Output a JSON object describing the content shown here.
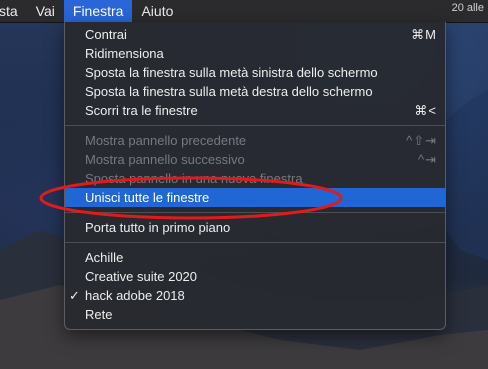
{
  "menubar": {
    "items": [
      "sta",
      "Vai",
      "Finestra",
      "Aiuto"
    ],
    "clock_fragment": "20 alle"
  },
  "menu": {
    "group1": [
      {
        "label": "Contrai",
        "shortcut": "⌘M"
      },
      {
        "label": "Ridimensiona",
        "shortcut": ""
      },
      {
        "label": "Sposta la finestra sulla metà sinistra dello schermo",
        "shortcut": ""
      },
      {
        "label": "Sposta la finestra sulla metà destra dello schermo",
        "shortcut": ""
      },
      {
        "label": "Scorri tra le finestre",
        "shortcut": "⌘<"
      }
    ],
    "group2": [
      {
        "label": "Mostra pannello precedente",
        "shortcut": "^⇧⇥",
        "disabled": true
      },
      {
        "label": "Mostra pannello successivo",
        "shortcut": "^⇥",
        "disabled": true
      },
      {
        "label": "Sposta pannello in una nuova finestra",
        "shortcut": "",
        "disabled": true
      },
      {
        "label": "Unisci tutte le finestre",
        "shortcut": "",
        "highlighted": true
      }
    ],
    "group3": [
      {
        "label": "Porta tutto in primo piano"
      }
    ],
    "group4": [
      {
        "label": "Achille",
        "checked": false
      },
      {
        "label": "Creative suite 2020",
        "checked": false
      },
      {
        "label": "hack adobe 2018",
        "checked": true,
        "check_glyph": "✓"
      },
      {
        "label": "Rete",
        "checked": false
      }
    ]
  },
  "colors": {
    "highlight": "#2066d4",
    "annotation": "#e01b1b",
    "menubar_active": "#2a66d8"
  }
}
